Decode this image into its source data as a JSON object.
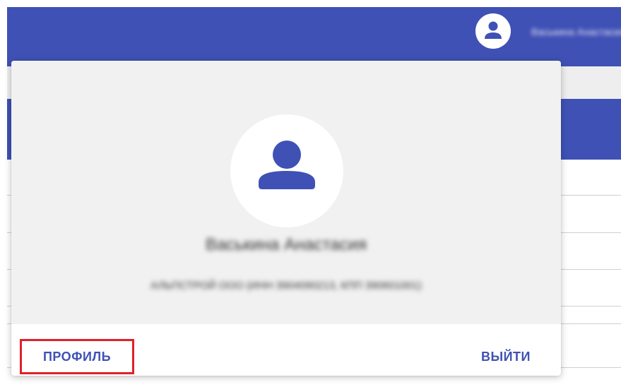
{
  "app": {
    "accent_color": "#3f51b5",
    "username": "Васькина Анастасия"
  },
  "topbar": {
    "avatar_icon": "account-circle-icon"
  },
  "popup": {
    "avatar_icon": "person-icon",
    "user_name": "Васькина Анастасия",
    "organization": "АЛЬПСТРОЙ ООО (ИНН 3904090213, КПП 390601001)",
    "profile_label": "ПРОФИЛЬ",
    "logout_label": "ВЫЙТИ",
    "highlight_color": "#e0202a"
  }
}
